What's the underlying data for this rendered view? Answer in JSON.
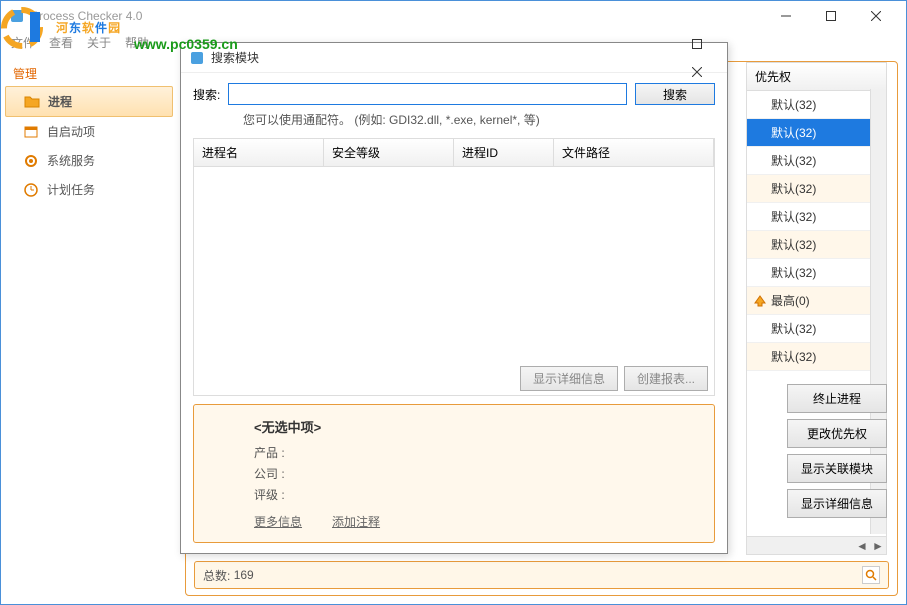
{
  "watermark": {
    "brand": "河东软件园",
    "url": "www.pc0359.cn"
  },
  "main": {
    "title": "Process Checker 4.0",
    "menu": {
      "file": "文件",
      "view": "查看",
      "about": "关于",
      "help": "帮助"
    }
  },
  "sidebar": {
    "header": "管理",
    "items": [
      {
        "label": "进程"
      },
      {
        "label": "自启动项"
      },
      {
        "label": "系统服务"
      },
      {
        "label": "计划任务"
      }
    ]
  },
  "priority": {
    "header": "优先权",
    "rows": [
      {
        "label": "默认(32)"
      },
      {
        "label": "默认(32)"
      },
      {
        "label": "默认(32)"
      },
      {
        "label": "默认(32)"
      },
      {
        "label": "默认(32)"
      },
      {
        "label": "默认(32)"
      },
      {
        "label": "默认(32)"
      },
      {
        "label": "最高(0)",
        "high": true
      },
      {
        "label": "默认(32)"
      },
      {
        "label": "默认(32)"
      }
    ]
  },
  "actions": {
    "terminate": "终止进程",
    "change_priority": "更改优先权",
    "show_modules": "显示关联模块",
    "show_detail": "显示详细信息"
  },
  "status": {
    "total_label": "总数:",
    "total_value": "169"
  },
  "dialog": {
    "title": "搜索模块",
    "search_label": "搜索:",
    "search_btn": "搜索",
    "hint": "您可以使用通配符。 (例如: GDI32.dll, *.exe, kernel*, 等)",
    "cols": {
      "name": "进程名",
      "level": "安全等级",
      "pid": "进程ID",
      "path": "文件路径"
    },
    "btn_detail": "显示详细信息",
    "btn_report": "创建报表...",
    "detail": {
      "no_selection": "<无选中项>",
      "product": "产品 :",
      "company": "公司 :",
      "rating": "评级 :",
      "more_info": "更多信息",
      "add_note": "添加注释"
    }
  }
}
